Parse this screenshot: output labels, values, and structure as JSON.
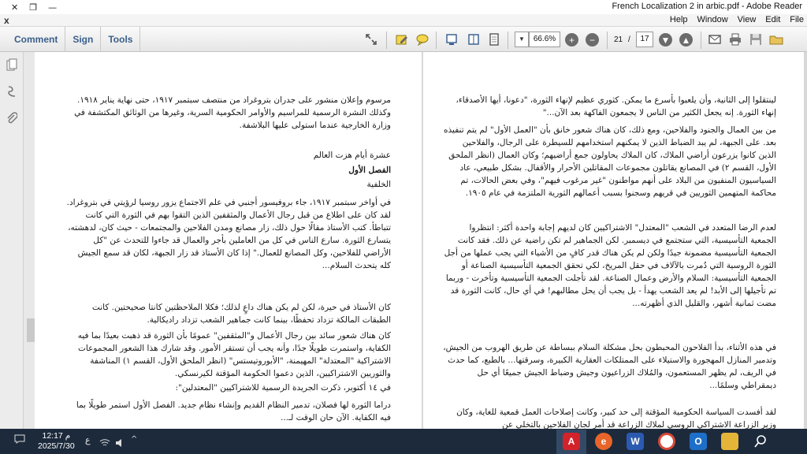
{
  "window": {
    "title": "French Localization 2 in arbic.pdf - Adobe Reader",
    "controls": {
      "close": "✕",
      "restore": "❐",
      "minimize": "—"
    }
  },
  "menubar": {
    "close": "x",
    "items": [
      "Help",
      "Window",
      "View",
      "Edit",
      "File"
    ]
  },
  "toolbar": {
    "tabs": [
      "Comment",
      "Sign",
      "Tools"
    ],
    "zoom": "66.6%",
    "page_current": "21",
    "page_separator": "/",
    "page_total": "17"
  },
  "document": {
    "left_page": {
      "block1": "مرسوم وإعلان منشور على جدران بتروغراد من منتصف سبتمبر ١٩١٧، حتى نهاية يناير ١٩١٨. وكذلك النشرة الرسمية للمراسيم والأوامر الحكومية السرية، وغيرها من الوثائق المكتشفة في وزارة الخارجية عندما استولى عليها البلاشفة.",
      "book_title": "عشرة أيام هزت العالم",
      "chapter": "الفصل الأول",
      "section": "الخلفية",
      "block2": "في أواخر سبتمبر ١٩١٧، جاء بروفيسور أجنبي في علم الاجتماع يزور روسيا لرؤيتي في بتروغراد. لقد كان على اطلاع من قبل رجال الأعمال والمثقفين الذين التقوا بهم في الثورة التي كانت تتباطأ. كتب الأستاذ مقالًا حول ذلك، زار مصانع ومدن الفلاحين والمجتمعات - حيث كان، لدهشته، يتسارع الثورة. سارع الناس في كل من العاملين بأجر والعمال قد جاءوا للتحدث عن \"كل الأراضي للفلاحين، وكل المصانع للعمال.\" إذا كان الأستاذ قد زار الجبهة، لكان قد سمع الجيش كله يتحدث السلام...",
      "block3": "كان الأستاذ في حيرة، لكن لم يكن هناك داعٍ لذلك؛ فكلا الملاحظتين كانتا صحيحتين. كانت الطبقات المالكة تزداد تحفظًا، بينما كانت جماهير الشعب تزداد راديكالية.",
      "block4": "كان هناك شعور سائد بين رجال الأعمال و\"المثقفين\" عمومًا بأن الثورة قد ذهبت بعيدًا بما فيه الكفاية، واستمرت طويلًا جدًا، وأنه يجب أن تستقر الأمور. وقد شارك هذا الشعور المجموعات الاشتراكية \"المعتدلة\" المهيمنة، \"الأبوروتيستس\" (انظر الملحق الأول، القسم ١) المناشفة والثوريين الاشتراكيين، الذين دعموا الحكومة المؤقتة لكيرنسكي.",
      "block5": "في ١٤ أكتوبر، ذكرت الجريدة الرسمية للاشتراكيين \"المعتدلين\":",
      "block6": "دراما الثورة لها فصلان، تدمير النظام القديم وإنشاء نظام جديد. الفصل الأول استمر طويلًا بما فيه الكفاية. الآن حان الوقت لـ..."
    },
    "right_page": {
      "block1": "لينتقلوا إلى الثانية، وأن يلعبوا بأسرع ما يمكن. كثوري عظيم لإنهاء الثورة، \"دعونا، أيها الأصدقاء، إنهاء الثورة. إنه يجعل الكثير من الناس لا يجمعون الفاكهة بعد الآن...\"",
      "block2": "من بين العمال والجنود والفلاحين، ومع ذلك، كان هناك شعور خانق بأن \"العمل الأول\" لم يتم تنفيذه بعد. على الجبهة، لم يبد الضباط الذين لا يمكنهم استخدامهم للسيطرة على الرجال، والفلاحين الذين كانوا يزرعون أراضي الملاك، كان الملاك يحاولون جمع أراضيهم؛ وكان العمال (انظر الملحق الأول، القسم ٢) في المصانع يقاتلون مجموعات المقاتلين الأحرار والأقفال. بشكل طبيعي، عاد السياسيون المنفيون من البلاد على أنهم مواطنون \"غير مرغوب فيهم\"، وفي بعض الحالات، تم محاكمة المتهمين الثوريين في قريهم وسجنوا بسبب أعمالهم الثورية الملتزمة في عام ١٩٠٥.",
      "block3": "لعدم الرضا المتعدد في الشعب \"المعتدل\" الاشتراكيين كان لديهم إجابة واحدة أكثر: انتظروا الجمعية التأسيسية، التي ستجتمع في ديسمبر. لكن الجماهير لم تكن راضية عن ذلك. فقد كانت الجمعية التأسيسية مضمونة جيدًا ولكن لم يكن هناك قدر كافٍ من الأشياء التي يجب عملها من أجل الثورة الروسية التي دُمرت بالآلاف في حقل المريخ، لكي تحقق الجمعية التأسيسية الصناعة أو الجمعية التأسيسية: السلام والأرض وعمال الصناعة. لقد تأجلت الجمعية التأسيسية وتأخرت - وربما تم تأجيلها إلى الأبد! لم يعد الشعب يهدأ - بل يجب أن يحل مطالبهم! في أي حال، كانت الثورة قد مضت ثمانية أشهر، والقليل الذي أظهرته...",
      "block4": "في هذه الأثناء، بدأ الفلاحون المحبطون بحل مشكلة السلام ببساطة عن طريق الهروب من الجيش، وتدمير المنازل المهجورة والاستيلاء على الممتلكات العقارية الكبيرة، وسرقتها... بالطبع، كما حدث في الريف، لم يظهر المستعمون، والمُلاك الزراعيون وجيش وضباط الجيش جميعًا أي حل ديمقراطي وسلمًا...",
      "block5": "لقد أفسدت السياسة الحكومية المؤقتة إلى حد كبير، وكانت إصلاحات العمل قمعية للغاية، وكان وزير الزراعة الاشتراكي الروسي لملاك الزراعة قد أمر لجان الفلاحين بالتخلي عن"
    }
  },
  "taskbar": {
    "time": "12:17 م",
    "date": "2025/7/30",
    "lang": "ع",
    "apps": [
      "Acrobat",
      "Firefox",
      "Word",
      "Chrome",
      "Outlook",
      "Explorer",
      "Search"
    ]
  },
  "colors": {
    "tab_text": "#3a5f8a",
    "taskbar": "#1c2a3c",
    "acrobat_red": "#d2232a"
  }
}
